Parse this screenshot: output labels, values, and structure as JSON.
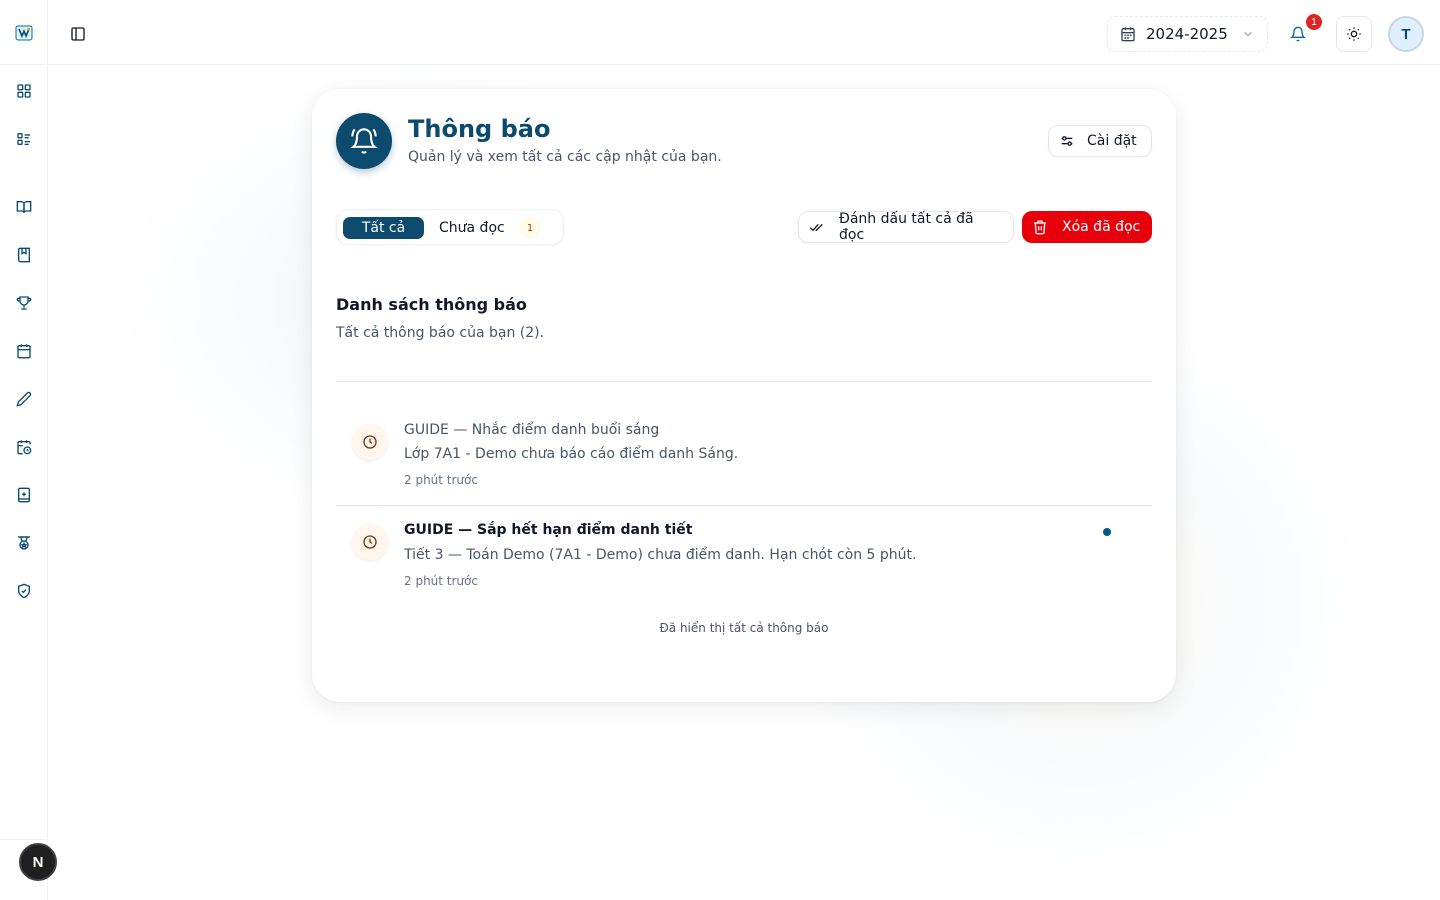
{
  "header": {
    "year": "2024-2025",
    "notification_count": "1",
    "avatar_initial": "T"
  },
  "sidebar": {
    "items": [
      {
        "icon": "dashboard-icon"
      },
      {
        "icon": "list-icon"
      },
      {
        "icon": "book-open-icon"
      },
      {
        "icon": "bookmark-book-icon"
      },
      {
        "icon": "trophy-icon"
      },
      {
        "icon": "calendar-icon"
      },
      {
        "icon": "pen-icon"
      },
      {
        "icon": "calendar-clock-icon"
      },
      {
        "icon": "book-plus-icon"
      },
      {
        "icon": "medal-icon"
      },
      {
        "icon": "shield-check-icon"
      }
    ],
    "footer_badge": "N"
  },
  "page": {
    "title": "Thông báo",
    "subtitle": "Quản lý và xem tất cả các cập nhật của bạn.",
    "settings_label": "Cài đặt",
    "tabs": {
      "all": "Tất cả",
      "unread": "Chưa đọc",
      "unread_count": "1"
    },
    "mark_all_read_label": "Đánh dấu tất cả đã đọc",
    "delete_read_label": "Xóa đã đọc",
    "list_title": "Danh sách thông báo",
    "list_subtitle": "Tất cả thông báo của bạn (2).",
    "notifications": [
      {
        "title": "GUIDE — Nhắc điểm danh buổi sáng",
        "body": "Lớp 7A1 - Demo chưa báo cáo điểm danh Sáng.",
        "time": "2 phút trước",
        "read": true
      },
      {
        "title": "GUIDE — Sắp hết hạn điểm danh tiết",
        "body": "Tiết 3 — Toán Demo (7A1 - Demo) chưa điểm danh. Hạn chót còn 5 phút.",
        "time": "2 phút trước",
        "read": false
      }
    ],
    "end_text": "Đã hiển thị tất cả thông báo"
  },
  "colors": {
    "primary": "#0c4a6e",
    "danger": "#e7000b",
    "unread_dot": "#075985"
  }
}
